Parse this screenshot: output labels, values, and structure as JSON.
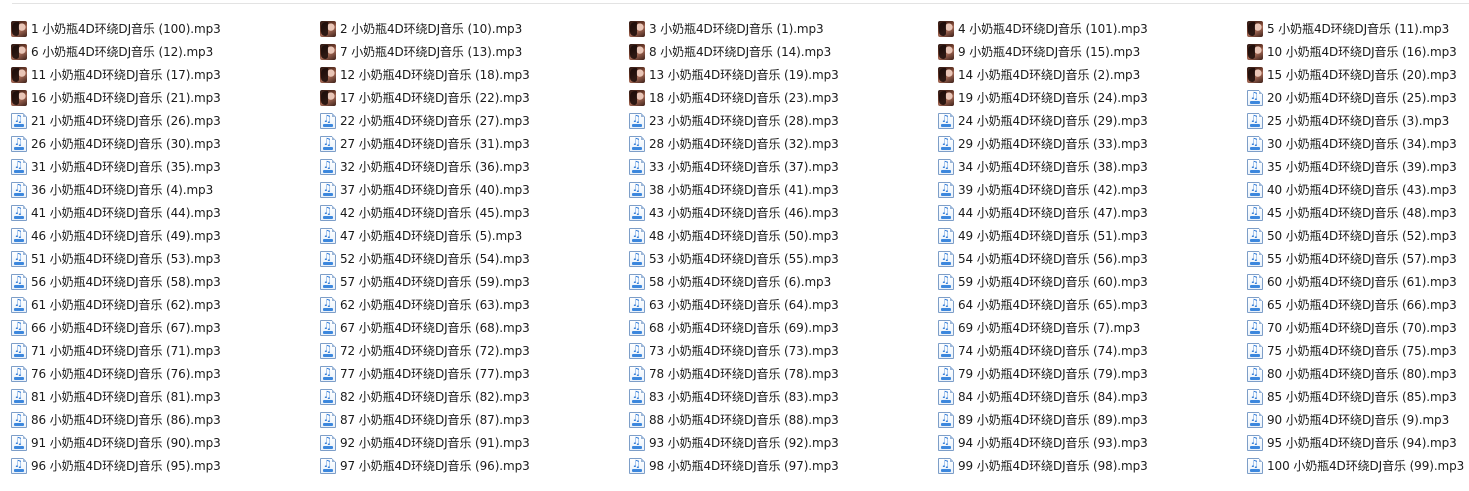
{
  "explorer": {
    "files": [
      {
        "name": "1 小奶瓶4D环绕DJ音乐 (100).mp3",
        "icon": "album-thumbnail-icon"
      },
      {
        "name": "2 小奶瓶4D环绕DJ音乐 (10).mp3",
        "icon": "album-thumbnail-icon"
      },
      {
        "name": "3 小奶瓶4D环绕DJ音乐 (1).mp3",
        "icon": "album-thumbnail-icon"
      },
      {
        "name": "4 小奶瓶4D环绕DJ音乐 (101).mp3",
        "icon": "album-thumbnail-icon"
      },
      {
        "name": "5 小奶瓶4D环绕DJ音乐 (11).mp3",
        "icon": "album-thumbnail-icon"
      },
      {
        "name": "6 小奶瓶4D环绕DJ音乐 (12).mp3",
        "icon": "album-thumbnail-icon"
      },
      {
        "name": "7 小奶瓶4D环绕DJ音乐 (13).mp3",
        "icon": "album-thumbnail-icon"
      },
      {
        "name": "8 小奶瓶4D环绕DJ音乐 (14).mp3",
        "icon": "album-thumbnail-icon"
      },
      {
        "name": "9 小奶瓶4D环绕DJ音乐 (15).mp3",
        "icon": "album-thumbnail-icon"
      },
      {
        "name": "10 小奶瓶4D环绕DJ音乐 (16).mp3",
        "icon": "album-thumbnail-icon"
      },
      {
        "name": "11 小奶瓶4D环绕DJ音乐 (17).mp3",
        "icon": "album-thumbnail-icon"
      },
      {
        "name": "12 小奶瓶4D环绕DJ音乐 (18).mp3",
        "icon": "album-thumbnail-icon"
      },
      {
        "name": "13 小奶瓶4D环绕DJ音乐 (19).mp3",
        "icon": "album-thumbnail-icon"
      },
      {
        "name": "14 小奶瓶4D环绕DJ音乐 (2).mp3",
        "icon": "album-thumbnail-icon"
      },
      {
        "name": "15 小奶瓶4D环绕DJ音乐 (20).mp3",
        "icon": "album-thumbnail-icon"
      },
      {
        "name": "16 小奶瓶4D环绕DJ音乐 (21).mp3",
        "icon": "album-thumbnail-icon"
      },
      {
        "name": "17 小奶瓶4D环绕DJ音乐 (22).mp3",
        "icon": "album-thumbnail-icon"
      },
      {
        "name": "18 小奶瓶4D环绕DJ音乐 (23).mp3",
        "icon": "album-thumbnail-icon"
      },
      {
        "name": "19 小奶瓶4D环绕DJ音乐 (24).mp3",
        "icon": "album-thumbnail-icon"
      },
      {
        "name": "20 小奶瓶4D环绕DJ音乐 (25).mp3",
        "icon": "audio-file-icon"
      },
      {
        "name": "21 小奶瓶4D环绕DJ音乐 (26).mp3",
        "icon": "audio-file-icon"
      },
      {
        "name": "22 小奶瓶4D环绕DJ音乐 (27).mp3",
        "icon": "audio-file-icon"
      },
      {
        "name": "23 小奶瓶4D环绕DJ音乐 (28).mp3",
        "icon": "audio-file-icon"
      },
      {
        "name": "24 小奶瓶4D环绕DJ音乐 (29).mp3",
        "icon": "audio-file-icon"
      },
      {
        "name": "25 小奶瓶4D环绕DJ音乐 (3).mp3",
        "icon": "audio-file-icon"
      },
      {
        "name": "26 小奶瓶4D环绕DJ音乐 (30).mp3",
        "icon": "audio-file-icon"
      },
      {
        "name": "27 小奶瓶4D环绕DJ音乐 (31).mp3",
        "icon": "audio-file-icon"
      },
      {
        "name": "28 小奶瓶4D环绕DJ音乐 (32).mp3",
        "icon": "audio-file-icon"
      },
      {
        "name": "29 小奶瓶4D环绕DJ音乐 (33).mp3",
        "icon": "audio-file-icon"
      },
      {
        "name": "30 小奶瓶4D环绕DJ音乐 (34).mp3",
        "icon": "audio-file-icon"
      },
      {
        "name": "31 小奶瓶4D环绕DJ音乐 (35).mp3",
        "icon": "audio-file-icon"
      },
      {
        "name": "32 小奶瓶4D环绕DJ音乐 (36).mp3",
        "icon": "audio-file-icon"
      },
      {
        "name": "33 小奶瓶4D环绕DJ音乐 (37).mp3",
        "icon": "audio-file-icon"
      },
      {
        "name": "34 小奶瓶4D环绕DJ音乐 (38).mp3",
        "icon": "audio-file-icon"
      },
      {
        "name": "35 小奶瓶4D环绕DJ音乐 (39).mp3",
        "icon": "audio-file-icon"
      },
      {
        "name": "36 小奶瓶4D环绕DJ音乐 (4).mp3",
        "icon": "audio-file-icon"
      },
      {
        "name": "37 小奶瓶4D环绕DJ音乐 (40).mp3",
        "icon": "audio-file-icon"
      },
      {
        "name": "38 小奶瓶4D环绕DJ音乐 (41).mp3",
        "icon": "audio-file-icon"
      },
      {
        "name": "39 小奶瓶4D环绕DJ音乐 (42).mp3",
        "icon": "audio-file-icon"
      },
      {
        "name": "40 小奶瓶4D环绕DJ音乐 (43).mp3",
        "icon": "audio-file-icon"
      },
      {
        "name": "41 小奶瓶4D环绕DJ音乐 (44).mp3",
        "icon": "audio-file-icon"
      },
      {
        "name": "42 小奶瓶4D环绕DJ音乐 (45).mp3",
        "icon": "audio-file-icon"
      },
      {
        "name": "43 小奶瓶4D环绕DJ音乐 (46).mp3",
        "icon": "audio-file-icon"
      },
      {
        "name": "44 小奶瓶4D环绕DJ音乐 (47).mp3",
        "icon": "audio-file-icon"
      },
      {
        "name": "45 小奶瓶4D环绕DJ音乐 (48).mp3",
        "icon": "audio-file-icon"
      },
      {
        "name": "46 小奶瓶4D环绕DJ音乐 (49).mp3",
        "icon": "audio-file-icon"
      },
      {
        "name": "47 小奶瓶4D环绕DJ音乐 (5).mp3",
        "icon": "audio-file-icon"
      },
      {
        "name": "48 小奶瓶4D环绕DJ音乐 (50).mp3",
        "icon": "audio-file-icon"
      },
      {
        "name": "49 小奶瓶4D环绕DJ音乐 (51).mp3",
        "icon": "audio-file-icon"
      },
      {
        "name": "50 小奶瓶4D环绕DJ音乐 (52).mp3",
        "icon": "audio-file-icon"
      },
      {
        "name": "51 小奶瓶4D环绕DJ音乐 (53).mp3",
        "icon": "audio-file-icon"
      },
      {
        "name": "52 小奶瓶4D环绕DJ音乐 (54).mp3",
        "icon": "audio-file-icon"
      },
      {
        "name": "53 小奶瓶4D环绕DJ音乐 (55).mp3",
        "icon": "audio-file-icon"
      },
      {
        "name": "54 小奶瓶4D环绕DJ音乐 (56).mp3",
        "icon": "audio-file-icon"
      },
      {
        "name": "55 小奶瓶4D环绕DJ音乐 (57).mp3",
        "icon": "audio-file-icon"
      },
      {
        "name": "56 小奶瓶4D环绕DJ音乐 (58).mp3",
        "icon": "audio-file-icon"
      },
      {
        "name": "57 小奶瓶4D环绕DJ音乐 (59).mp3",
        "icon": "audio-file-icon"
      },
      {
        "name": "58 小奶瓶4D环绕DJ音乐 (6).mp3",
        "icon": "audio-file-icon"
      },
      {
        "name": "59 小奶瓶4D环绕DJ音乐 (60).mp3",
        "icon": "audio-file-icon"
      },
      {
        "name": "60 小奶瓶4D环绕DJ音乐 (61).mp3",
        "icon": "audio-file-icon"
      },
      {
        "name": "61 小奶瓶4D环绕DJ音乐 (62).mp3",
        "icon": "audio-file-icon"
      },
      {
        "name": "62 小奶瓶4D环绕DJ音乐 (63).mp3",
        "icon": "audio-file-icon"
      },
      {
        "name": "63 小奶瓶4D环绕DJ音乐 (64).mp3",
        "icon": "audio-file-icon"
      },
      {
        "name": "64 小奶瓶4D环绕DJ音乐 (65).mp3",
        "icon": "audio-file-icon"
      },
      {
        "name": "65 小奶瓶4D环绕DJ音乐 (66).mp3",
        "icon": "audio-file-icon"
      },
      {
        "name": "66 小奶瓶4D环绕DJ音乐 (67).mp3",
        "icon": "audio-file-icon"
      },
      {
        "name": "67 小奶瓶4D环绕DJ音乐 (68).mp3",
        "icon": "audio-file-icon"
      },
      {
        "name": "68 小奶瓶4D环绕DJ音乐 (69).mp3",
        "icon": "audio-file-icon"
      },
      {
        "name": "69 小奶瓶4D环绕DJ音乐 (7).mp3",
        "icon": "audio-file-icon"
      },
      {
        "name": "70 小奶瓶4D环绕DJ音乐 (70).mp3",
        "icon": "audio-file-icon"
      },
      {
        "name": "71 小奶瓶4D环绕DJ音乐 (71).mp3",
        "icon": "audio-file-icon"
      },
      {
        "name": "72 小奶瓶4D环绕DJ音乐 (72).mp3",
        "icon": "audio-file-icon"
      },
      {
        "name": "73 小奶瓶4D环绕DJ音乐 (73).mp3",
        "icon": "audio-file-icon"
      },
      {
        "name": "74 小奶瓶4D环绕DJ音乐 (74).mp3",
        "icon": "audio-file-icon"
      },
      {
        "name": "75 小奶瓶4D环绕DJ音乐 (75).mp3",
        "icon": "audio-file-icon"
      },
      {
        "name": "76 小奶瓶4D环绕DJ音乐 (76).mp3",
        "icon": "audio-file-icon"
      },
      {
        "name": "77 小奶瓶4D环绕DJ音乐 (77).mp3",
        "icon": "audio-file-icon"
      },
      {
        "name": "78 小奶瓶4D环绕DJ音乐 (78).mp3",
        "icon": "audio-file-icon"
      },
      {
        "name": "79 小奶瓶4D环绕DJ音乐 (79).mp3",
        "icon": "audio-file-icon"
      },
      {
        "name": "80 小奶瓶4D环绕DJ音乐 (80).mp3",
        "icon": "audio-file-icon"
      },
      {
        "name": "81 小奶瓶4D环绕DJ音乐 (81).mp3",
        "icon": "audio-file-icon"
      },
      {
        "name": "82 小奶瓶4D环绕DJ音乐 (82).mp3",
        "icon": "audio-file-icon"
      },
      {
        "name": "83 小奶瓶4D环绕DJ音乐 (83).mp3",
        "icon": "audio-file-icon"
      },
      {
        "name": "84 小奶瓶4D环绕DJ音乐 (84).mp3",
        "icon": "audio-file-icon"
      },
      {
        "name": "85 小奶瓶4D环绕DJ音乐 (85).mp3",
        "icon": "audio-file-icon"
      },
      {
        "name": "86 小奶瓶4D环绕DJ音乐 (86).mp3",
        "icon": "audio-file-icon"
      },
      {
        "name": "87 小奶瓶4D环绕DJ音乐 (87).mp3",
        "icon": "audio-file-icon"
      },
      {
        "name": "88 小奶瓶4D环绕DJ音乐 (88).mp3",
        "icon": "audio-file-icon"
      },
      {
        "name": "89 小奶瓶4D环绕DJ音乐 (89).mp3",
        "icon": "audio-file-icon"
      },
      {
        "name": "90 小奶瓶4D环绕DJ音乐 (9).mp3",
        "icon": "audio-file-icon"
      },
      {
        "name": "91 小奶瓶4D环绕DJ音乐 (90).mp3",
        "icon": "audio-file-icon"
      },
      {
        "name": "92 小奶瓶4D环绕DJ音乐 (91).mp3",
        "icon": "audio-file-icon"
      },
      {
        "name": "93 小奶瓶4D环绕DJ音乐 (92).mp3",
        "icon": "audio-file-icon"
      },
      {
        "name": "94 小奶瓶4D环绕DJ音乐 (93).mp3",
        "icon": "audio-file-icon"
      },
      {
        "name": "95 小奶瓶4D环绕DJ音乐 (94).mp3",
        "icon": "audio-file-icon"
      },
      {
        "name": "96 小奶瓶4D环绕DJ音乐 (95).mp3",
        "icon": "audio-file-icon"
      },
      {
        "name": "97 小奶瓶4D环绕DJ音乐 (96).mp3",
        "icon": "audio-file-icon"
      },
      {
        "name": "98 小奶瓶4D环绕DJ音乐 (97).mp3",
        "icon": "audio-file-icon"
      },
      {
        "name": "99 小奶瓶4D环绕DJ音乐 (98).mp3",
        "icon": "audio-file-icon"
      },
      {
        "name": "100 小奶瓶4D环绕DJ音乐 (99).mp3",
        "icon": "audio-file-icon"
      }
    ]
  }
}
